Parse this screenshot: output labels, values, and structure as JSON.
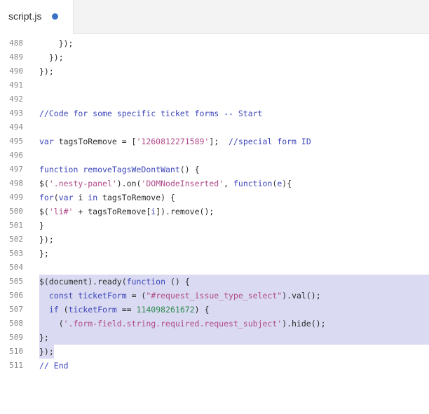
{
  "tab": {
    "filename": "script.js",
    "modified_indicator": "unsaved-dot"
  },
  "colors": {
    "keyword": "#3c46b8",
    "string": "#b04a8a",
    "number": "#2f8a4f",
    "comment": "#3c46b8",
    "selection": "#dadaf2",
    "modified_dot": "#3a73c6"
  },
  "editor": {
    "lines": [
      {
        "n": "488",
        "hl": false,
        "tokens": [
          {
            "t": "p",
            "v": "    });"
          }
        ]
      },
      {
        "n": "489",
        "hl": false,
        "tokens": [
          {
            "t": "p",
            "v": "  });"
          }
        ]
      },
      {
        "n": "490",
        "hl": false,
        "tokens": [
          {
            "t": "p",
            "v": "});"
          }
        ]
      },
      {
        "n": "491",
        "hl": false,
        "tokens": []
      },
      {
        "n": "492",
        "hl": false,
        "tokens": []
      },
      {
        "n": "493",
        "hl": false,
        "tokens": [
          {
            "t": "cm",
            "v": "//Code for some specific ticket forms -- Start"
          }
        ]
      },
      {
        "n": "494",
        "hl": false,
        "tokens": []
      },
      {
        "n": "495",
        "hl": false,
        "tokens": [
          {
            "t": "kw",
            "v": "var "
          },
          {
            "t": "p",
            "v": "tagsToRemove = ["
          },
          {
            "t": "str",
            "v": "'1260812271589'"
          },
          {
            "t": "p",
            "v": "];  "
          },
          {
            "t": "cm",
            "v": "//special form ID"
          }
        ]
      },
      {
        "n": "496",
        "hl": false,
        "tokens": []
      },
      {
        "n": "497",
        "hl": false,
        "tokens": [
          {
            "t": "kw",
            "v": "function "
          },
          {
            "t": "fn",
            "v": "removeTagsWeDontWant"
          },
          {
            "t": "p",
            "v": "() {"
          }
        ]
      },
      {
        "n": "498",
        "hl": false,
        "tokens": [
          {
            "t": "p",
            "v": "$("
          },
          {
            "t": "str",
            "v": "'.nesty-panel'"
          },
          {
            "t": "p",
            "v": ").on("
          },
          {
            "t": "str",
            "v": "'DOMNodeInserted'"
          },
          {
            "t": "p",
            "v": ", "
          },
          {
            "t": "kw",
            "v": "function"
          },
          {
            "t": "p",
            "v": "("
          },
          {
            "t": "id",
            "v": "e"
          },
          {
            "t": "p",
            "v": "){"
          }
        ]
      },
      {
        "n": "499",
        "hl": false,
        "tokens": [
          {
            "t": "kw",
            "v": "for"
          },
          {
            "t": "p",
            "v": "("
          },
          {
            "t": "kw",
            "v": "var "
          },
          {
            "t": "p",
            "v": "i "
          },
          {
            "t": "kw",
            "v": "in "
          },
          {
            "t": "p",
            "v": "tagsToRemove) {"
          }
        ]
      },
      {
        "n": "500",
        "hl": false,
        "tokens": [
          {
            "t": "p",
            "v": "$("
          },
          {
            "t": "str",
            "v": "'li#'"
          },
          {
            "t": "p",
            "v": " + tagsToRemove["
          },
          {
            "t": "id",
            "v": "i"
          },
          {
            "t": "p",
            "v": "]).remove();"
          }
        ]
      },
      {
        "n": "501",
        "hl": false,
        "tokens": [
          {
            "t": "p",
            "v": "}"
          }
        ]
      },
      {
        "n": "502",
        "hl": false,
        "tokens": [
          {
            "t": "p",
            "v": "});"
          }
        ]
      },
      {
        "n": "503",
        "hl": false,
        "tokens": [
          {
            "t": "p",
            "v": "};"
          }
        ]
      },
      {
        "n": "504",
        "hl": false,
        "tokens": []
      },
      {
        "n": "505",
        "hl": true,
        "tokens": [
          {
            "t": "p",
            "v": "$(document).ready("
          },
          {
            "t": "kw",
            "v": "function"
          },
          {
            "t": "p",
            "v": " () {"
          }
        ]
      },
      {
        "n": "506",
        "hl": true,
        "tokens": [
          {
            "t": "p",
            "v": "  "
          },
          {
            "t": "kw",
            "v": "const "
          },
          {
            "t": "id",
            "v": "ticketForm"
          },
          {
            "t": "p",
            "v": " = ("
          },
          {
            "t": "str",
            "v": "\"#request_issue_type_select\""
          },
          {
            "t": "p",
            "v": ").val();"
          }
        ]
      },
      {
        "n": "507",
        "hl": true,
        "tokens": [
          {
            "t": "p",
            "v": "  "
          },
          {
            "t": "kw",
            "v": "if "
          },
          {
            "t": "p",
            "v": "("
          },
          {
            "t": "id",
            "v": "ticketForm"
          },
          {
            "t": "p",
            "v": " == "
          },
          {
            "t": "num",
            "v": "114098261672"
          },
          {
            "t": "p",
            "v": ") {"
          }
        ]
      },
      {
        "n": "508",
        "hl": true,
        "tokens": [
          {
            "t": "p",
            "v": "    ("
          },
          {
            "t": "str",
            "v": "'.form-field.string.required.request_subject'"
          },
          {
            "t": "p",
            "v": ").hide();"
          }
        ]
      },
      {
        "n": "509",
        "hl": true,
        "tokens": [
          {
            "t": "p",
            "v": "};"
          }
        ]
      },
      {
        "n": "510",
        "hl": "partial",
        "tokens": [
          {
            "t": "p",
            "v": "});"
          }
        ]
      },
      {
        "n": "511",
        "hl": false,
        "tokens": [
          {
            "t": "cm",
            "v": "// End"
          }
        ]
      }
    ]
  }
}
